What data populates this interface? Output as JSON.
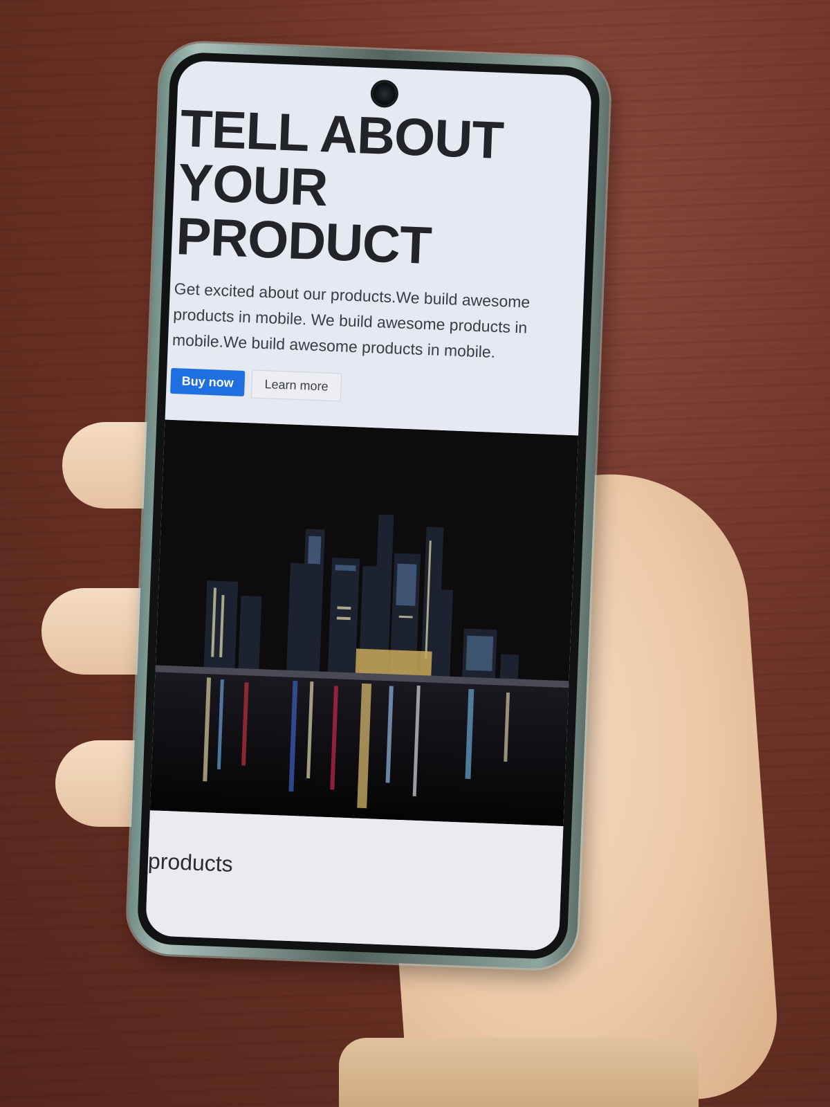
{
  "hero": {
    "title_lines": [
      "TELL ABOUT",
      "YOUR",
      "PRODUCT"
    ],
    "description": "Get excited about our products.We build awesome products in mobile. We build awesome products in mobile.We build awesome products in mobile.",
    "primary_button": "Buy now",
    "secondary_button": "Learn more"
  },
  "image": {
    "subject": "night city skyline with reflections on water"
  },
  "products": {
    "heading": "products"
  },
  "colors": {
    "primary_button": "#1f6fe0",
    "page_background": "#e6e8f2",
    "heading_text": "#222428"
  }
}
